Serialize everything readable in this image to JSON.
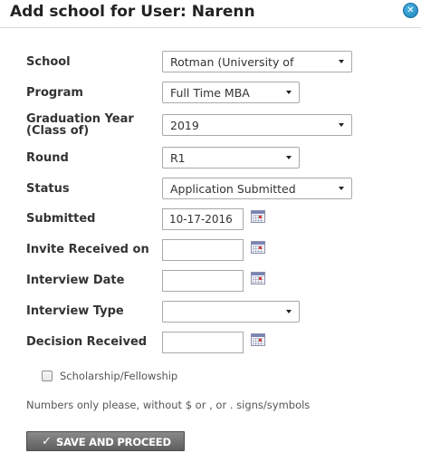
{
  "dialog": {
    "title": "Add school for User: Narenn",
    "close_icon": "close-icon"
  },
  "form": {
    "school": {
      "label": "School",
      "value": "Rotman (University of"
    },
    "program": {
      "label": "Program",
      "value": "Full Time MBA"
    },
    "graduation_year": {
      "label_line1": "Graduation Year",
      "label_line2": "(Class of)",
      "value": "2019"
    },
    "round": {
      "label": "Round",
      "value": "R1"
    },
    "status": {
      "label": "Status",
      "value": "Application Submitted"
    },
    "submitted": {
      "label": "Submitted",
      "value": "10-17-2016",
      "icon": "calendar-icon"
    },
    "invite_received": {
      "label": "Invite Received on",
      "value": "",
      "icon": "calendar-icon"
    },
    "interview_date": {
      "label": "Interview Date",
      "value": "",
      "icon": "calendar-icon"
    },
    "interview_type": {
      "label": "Interview Type",
      "value": ""
    },
    "decision_received": {
      "label": "Decision Received",
      "value": "",
      "icon": "calendar-icon"
    },
    "scholarship": {
      "label": "Scholarship/Fellowship",
      "checked": false
    },
    "note": "Numbers only please, without $ or , or . signs/symbols",
    "save_button": {
      "label": "SAVE AND PROCEED",
      "icon": "checkmark-icon"
    }
  },
  "colors": {
    "close_button": "#1b7fb5",
    "button_bg": "#6e6e6e",
    "calendar_accent": "#d03b3b"
  }
}
